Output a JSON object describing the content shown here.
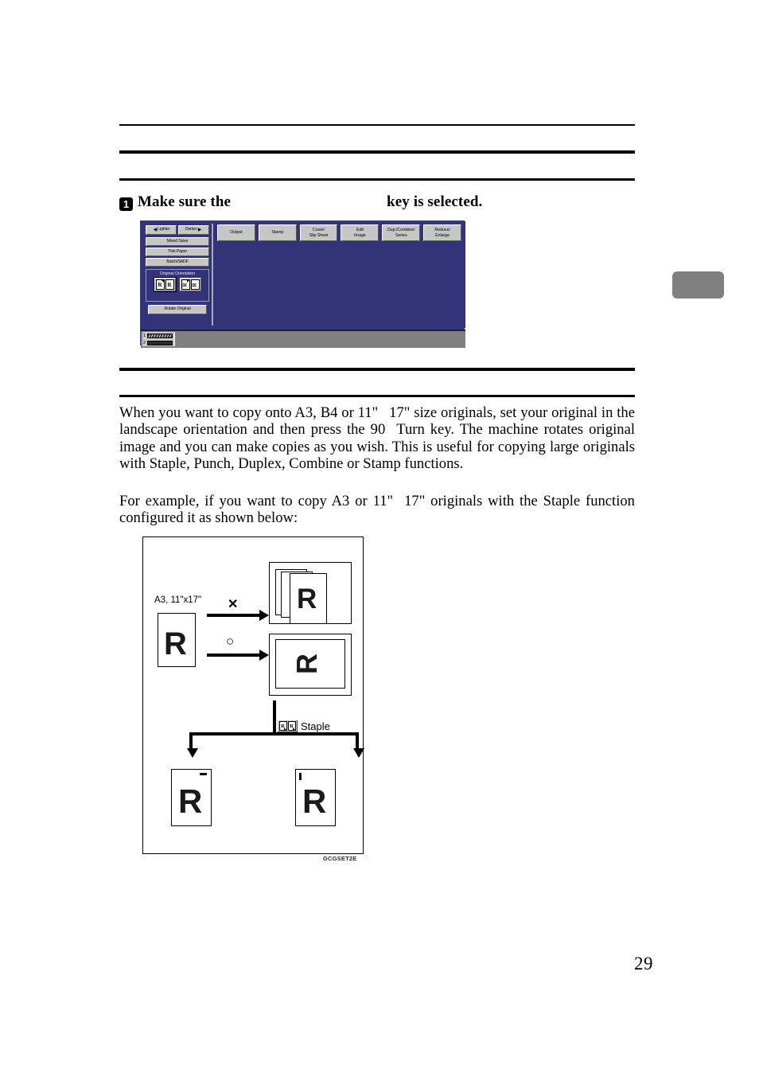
{
  "page": {
    "number": "29",
    "figure_caption": "GCGSET2E"
  },
  "step": {
    "badge": "1",
    "text_before": "Make sure the",
    "text_after": "key is selected."
  },
  "lcd": {
    "exposure": {
      "lighter_label": "Lighter",
      "darker_label": "Darker",
      "left_arrow": "◀",
      "right_arrow": "▶"
    },
    "left_buttons": [
      {
        "label": "Mixed Sizes"
      },
      {
        "label": "Thin Paper"
      },
      {
        "label": "Batch/SADF"
      }
    ],
    "original_orientation": {
      "title": "Original Orientation",
      "options": [
        {
          "name": "portrait-portrait",
          "selected": true,
          "cells": [
            "R",
            "R"
          ]
        },
        {
          "name": "landscape-landscape",
          "selected": false,
          "cells": [
            "R",
            "R"
          ]
        }
      ]
    },
    "rotate_original_label": "Rotate Original",
    "function_keys": [
      {
        "line1": "Output",
        "line2": ""
      },
      {
        "line1": "Stamp",
        "line2": ""
      },
      {
        "line1": "Cover/",
        "line2": "Slip Sheet"
      },
      {
        "line1": "Edit",
        "line2": "Image"
      },
      {
        "line1": "Dup./Combine/",
        "line2": "Series"
      },
      {
        "line1": "Reduce/",
        "line2": "Enlarge"
      }
    ],
    "trays": [
      {
        "number": "1"
      },
      {
        "number": "2"
      }
    ],
    "colors": {
      "screen_background": "#33337a",
      "button_face": "#c6c6c6",
      "status_bar": "#808080"
    }
  },
  "body": {
    "paragraph_1_a": "When you want to copy onto A3, B4 or 11\"",
    "paragraph_1_b": "17\" size originals, set your original in the landscape orientation and then press the 90",
    "paragraph_1_c": "Turn key. The machine rotates original image and you can make copies as you wish. This is useful for copying large originals with Staple, Punch, Duplex, Combine or Stamp functions.",
    "paragraph_2_a": "For example, if you want to copy A3 or 11\"",
    "paragraph_2_b": "17\" originals with the Staple function configured it as shown below:"
  },
  "figure": {
    "source_label": "A3, 11\"x17\"",
    "source_glyph": "R",
    "arrow_1_mark": "✕",
    "arrow_2_mark": "○",
    "result_1_glyph": "R",
    "result_2_glyph": "R",
    "staple_label": "Staple",
    "staple_mini_glyphs": [
      "R",
      "R"
    ],
    "output_1_glyph": "R",
    "output_2_glyph": "R"
  }
}
